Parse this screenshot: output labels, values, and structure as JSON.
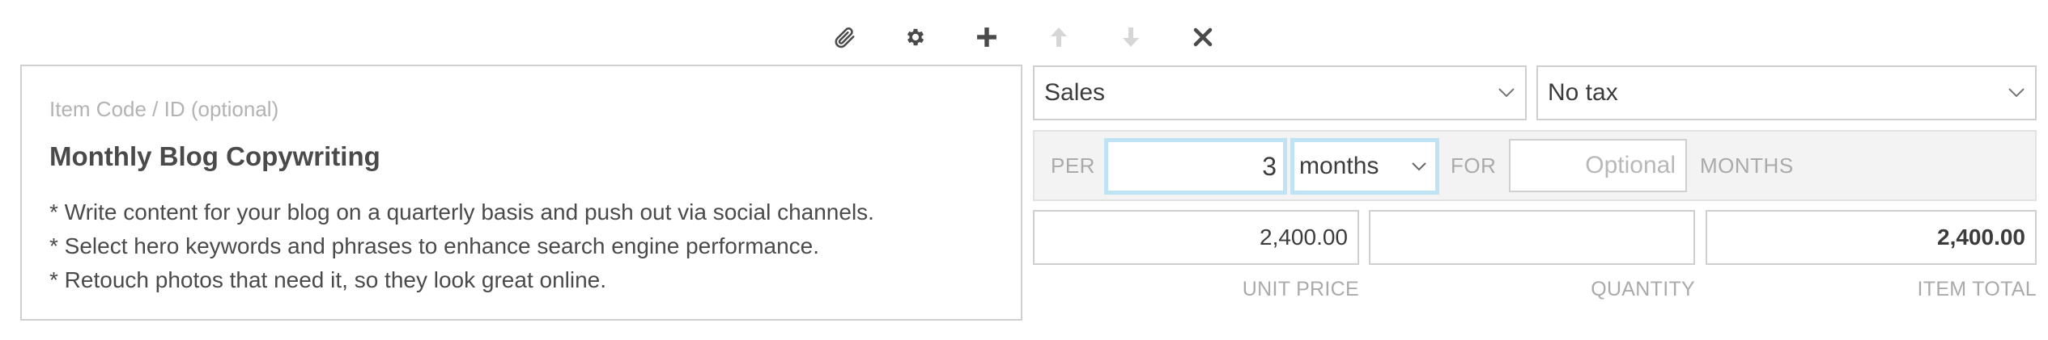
{
  "toolbar": {
    "buttons": [
      {
        "name": "attach",
        "icon": "paperclip-icon",
        "enabled": true
      },
      {
        "name": "settings",
        "icon": "gear-icon",
        "enabled": true
      },
      {
        "name": "add",
        "icon": "plus-icon",
        "enabled": true
      },
      {
        "name": "move-up",
        "icon": "arrow-up-icon",
        "enabled": false
      },
      {
        "name": "move-down",
        "icon": "arrow-down-icon",
        "enabled": false
      },
      {
        "name": "remove",
        "icon": "close-icon",
        "enabled": true
      }
    ]
  },
  "item": {
    "code_placeholder": "Item Code / ID (optional)",
    "title": "Monthly Blog Copywriting",
    "description_lines": [
      "* Write content for your blog on a quarterly basis and push out via social channels.",
      "* Select hero keywords and phrases to enhance search engine performance.",
      "* Retouch photos that need it, so they look great online."
    ]
  },
  "account": {
    "selected": "Sales"
  },
  "tax": {
    "selected": "No tax"
  },
  "recurring": {
    "per_label": "PER",
    "interval_value": "3",
    "interval_unit": "months",
    "for_label": "FOR",
    "duration_placeholder": "Optional",
    "duration_unit_label": "MONTHS"
  },
  "pricing": {
    "unit_price": "2,400.00",
    "quantity": "",
    "item_total": "2,400.00",
    "unit_price_label": "UNIT PRICE",
    "quantity_label": "QUANTITY",
    "item_total_label": "ITEM TOTAL"
  },
  "colors": {
    "icon": "#4a4a4a",
    "icon_disabled": "#d6d6d6",
    "focus_border": "#bfe2f5",
    "row_background": "#f3f3f3"
  }
}
